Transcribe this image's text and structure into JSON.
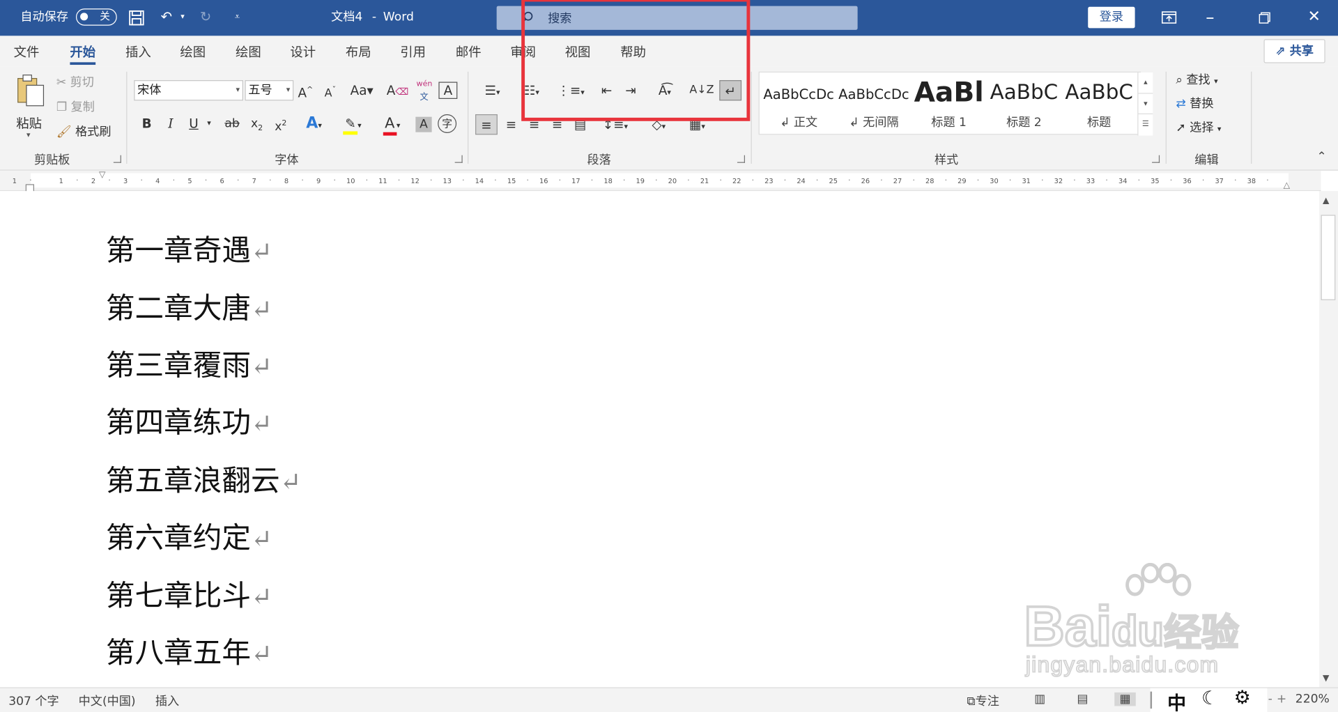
{
  "titlebar": {
    "autosave_label": "自动保存",
    "autosave_state": "关",
    "document_title": "文档4",
    "separator": "-",
    "app_name": "Word",
    "search_placeholder": "搜索",
    "login_label": "登录"
  },
  "tabs": [
    "文件",
    "开始",
    "插入",
    "绘图",
    "绘图",
    "设计",
    "布局",
    "引用",
    "邮件",
    "审阅",
    "视图",
    "帮助"
  ],
  "active_tab": "开始",
  "share_label": "共享",
  "clipboard": {
    "paste": "粘贴",
    "cut": "剪切",
    "copy": "复制",
    "format_painter": "格式刷",
    "group_label": "剪贴板"
  },
  "font": {
    "font_name": "宋体",
    "font_size": "五号",
    "phonetic_top": "wén",
    "phonetic_bottom": "文",
    "group_label": "字体",
    "highlight_color": "#ffff00",
    "font_color": "#e81123"
  },
  "paragraph": {
    "group_label": "段落"
  },
  "styles": {
    "items": [
      {
        "sample": "AaBbCcDc",
        "name": "正文"
      },
      {
        "sample": "AaBbCcDc",
        "name": "无间隔"
      },
      {
        "sample": "AaBl",
        "name": "标题 1"
      },
      {
        "sample": "AaBbC",
        "name": "标题 2"
      },
      {
        "sample": "AaBbC",
        "name": "标题"
      }
    ],
    "group_label": "样式"
  },
  "editing": {
    "find": "查找",
    "replace": "替换",
    "select": "选择",
    "group_label": "编辑"
  },
  "ruler": {
    "labels": [
      "1",
      "1",
      "2",
      "3",
      "4",
      "5",
      "6",
      "7",
      "8",
      "9",
      "10",
      "11",
      "12",
      "13",
      "14",
      "15",
      "16",
      "17",
      "18",
      "19",
      "20",
      "21",
      "22",
      "23",
      "24",
      "25",
      "26",
      "27",
      "28",
      "29",
      "30",
      "31",
      "32",
      "33",
      "34",
      "35",
      "36",
      "37",
      "38"
    ]
  },
  "document": {
    "lines": [
      "第一章奇遇",
      "第二章大唐",
      "第三章覆雨",
      "第四章练功",
      "第五章浪翻云",
      "第六章约定",
      "第七章比斗",
      "第八章五年"
    ],
    "paragraph_mark": "↵"
  },
  "statusbar": {
    "word_count": "307 个字",
    "language": "中文(中国)",
    "mode": "插入",
    "focus": "专注",
    "ime": "中",
    "zoom": "220%"
  },
  "watermark": {
    "brand": "Bai",
    "brand2": "du",
    "brand_cn": "经验",
    "url": "jingyan.baidu.com"
  },
  "colors": {
    "accent": "#2b579a",
    "highlight_box": "#e8343c"
  }
}
